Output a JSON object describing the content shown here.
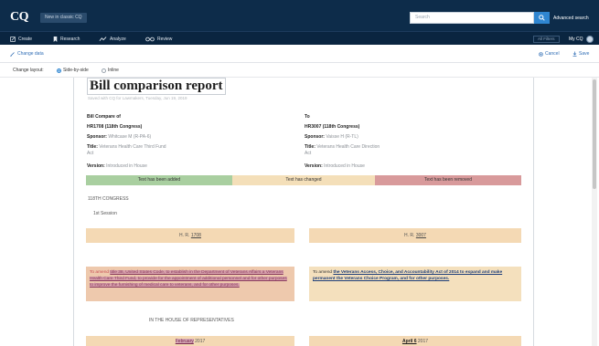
{
  "header": {
    "logo": "CQ",
    "new_cq": "New in classic CQ",
    "search_placeholder": "Search",
    "advanced_search": "Advanced search"
  },
  "nav": {
    "items": [
      {
        "label": "Create",
        "icon": "edit-icon"
      },
      {
        "label": "Research",
        "icon": "bookmark-icon"
      },
      {
        "label": "Analyze",
        "icon": "trend-icon"
      },
      {
        "label": "Review",
        "icon": "glasses-icon"
      }
    ],
    "filters": "All Filters",
    "my_cq": "My CQ"
  },
  "subbar": {
    "change_data": "Change data",
    "cancel": "Cancel",
    "save": "Save"
  },
  "layout": {
    "label": "Change layout:",
    "options": [
      "Side-by-side",
      "Inline"
    ],
    "selected": "Side-by-side"
  },
  "report": {
    "title": "Bill comparison report",
    "subtitle": "Saved with CQ for Lawmakers, Tuesday, Jun 19, 2019"
  },
  "left": {
    "heading": "Bill Compare of",
    "bill": "HR1708 (118th Congress)",
    "sponsor_label": "Sponsor:",
    "sponsor": "Whitcase M (R-PA-6)",
    "title_label": "Title:",
    "title_line1": "Veterans Health Care Third Fund",
    "title_line2": "Act",
    "version_label": "Version:",
    "version": "Introduced in House"
  },
  "right": {
    "heading": "To",
    "bill": "HR3007 (118th Congress)",
    "sponsor_label": "Sponsor:",
    "sponsor": "Vaisse H (R-TL)",
    "title_label": "Title:",
    "title_line1": "Veterans Health Care Direction",
    "title_line2": "Act",
    "version_label": "Version:",
    "version": "Introduced in House"
  },
  "legend": {
    "added": "Text has been added",
    "changed": "Text has changed",
    "removed": "Text has been removed"
  },
  "body": {
    "congress": "118TH CONGRESS",
    "session": "1st Session",
    "left_bill_prefix": "H. R.",
    "left_bill_no": "1708",
    "right_bill_prefix": "H. R.",
    "right_bill_no": "3007",
    "left_purpose_lead": "To amend ",
    "left_purpose_hl": "title 38, United States Code, to establish in the Department of Veterans Affairs a Veterans Health Care Third Fund, to provide for the appointment of additional personnel and for other purposes to improve the furnishing of medical care to veterans, and for other purposes.",
    "left_purpose_tail": "",
    "right_purpose_lead": "To amend ",
    "right_purpose_hl": "the Veterans Access, Choice, and Accountability Act of 2014 to expand and make permanent the Veterans Choice Program, and for other purposes.",
    "house": "IN THE HOUSE OF REPRESENTATIVES",
    "left_date_month": "February",
    "left_date_year": "2017",
    "right_date_month": "April 6",
    "right_date_year": "2017"
  }
}
